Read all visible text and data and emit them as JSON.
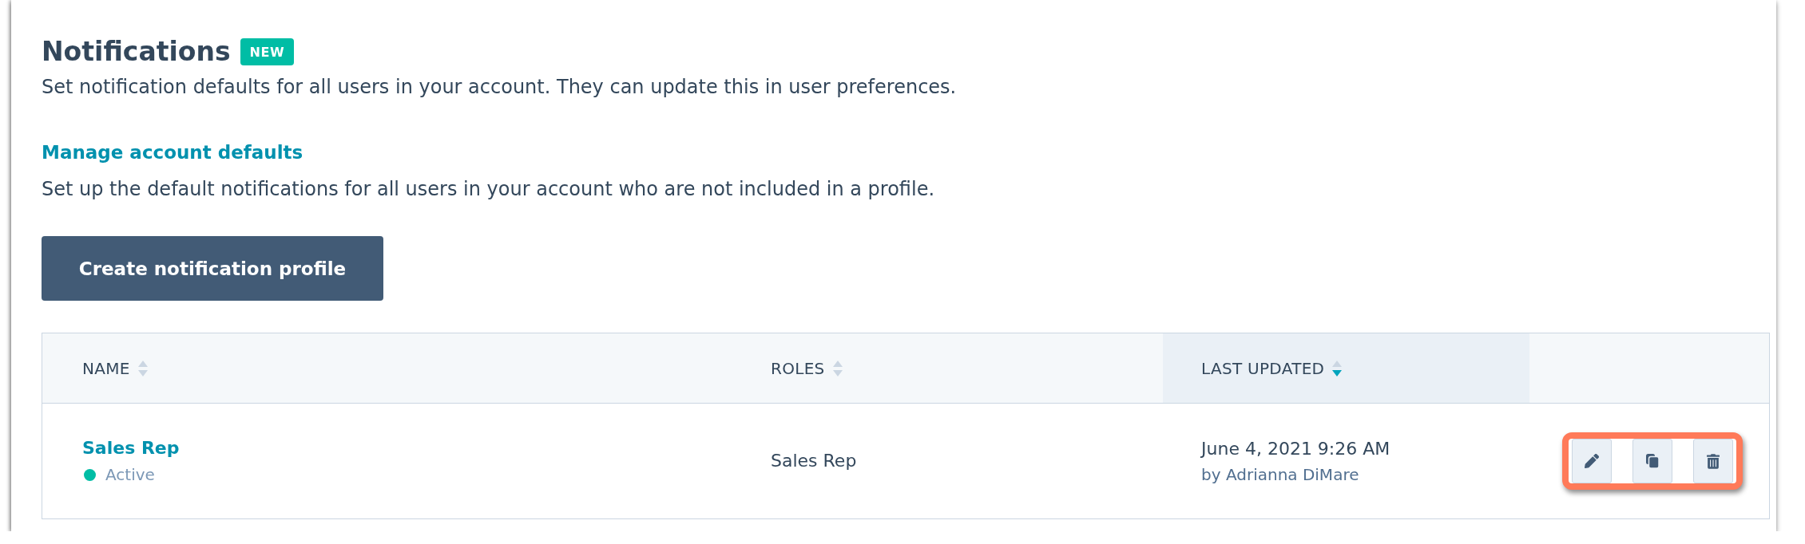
{
  "header": {
    "title": "Notifications",
    "badge": "NEW",
    "description": "Set notification defaults for all users in your account. They can update this in user preferences."
  },
  "defaults": {
    "link": "Manage account defaults",
    "description": "Set up the default notifications for all users in your account who are not included in a profile."
  },
  "create_button": "Create notification profile",
  "table": {
    "columns": [
      {
        "label": "NAME",
        "sorted": false
      },
      {
        "label": "ROLES",
        "sorted": false
      },
      {
        "label": "LAST UPDATED",
        "sorted": true,
        "descending": true
      }
    ],
    "rows": [
      {
        "name": "Sales Rep",
        "status": {
          "label": "Active",
          "color": "#00bda5"
        },
        "roles": "Sales Rep",
        "updated": "June 4, 2021 9:26 AM",
        "updated_by": "by Adrianna DiMare",
        "actions": {
          "highlighted": true,
          "items": [
            {
              "kind": "edit"
            },
            {
              "kind": "clone"
            },
            {
              "kind": "delete"
            }
          ]
        }
      }
    ]
  }
}
